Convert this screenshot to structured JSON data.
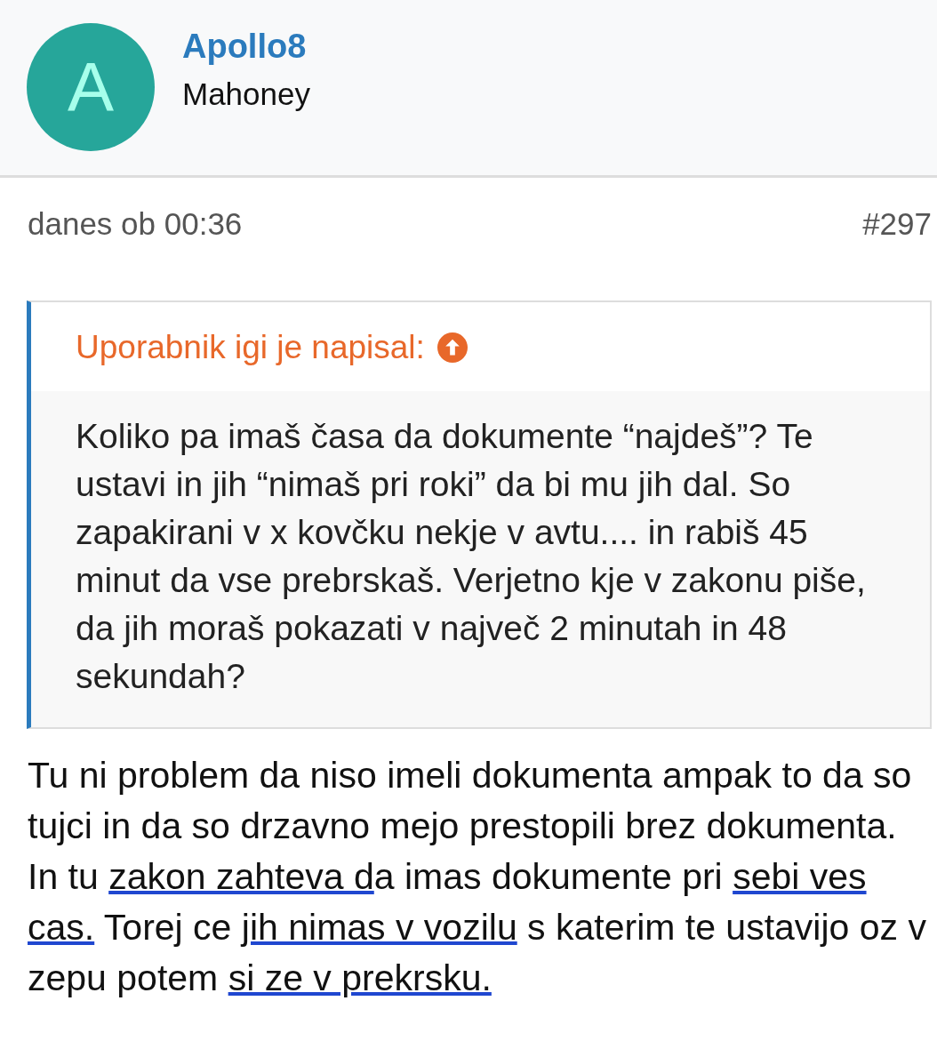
{
  "author": {
    "avatar_letter": "A",
    "username": "Apollo8",
    "subtitle": "Mahoney"
  },
  "post_meta": {
    "time": "danes ob 00:36",
    "number": "#297"
  },
  "quote": {
    "attribution": "Uporabnik igi je napisal:",
    "text": "Koliko pa imaš časa da dokumente “najdeš”? Te ustavi in jih “nimaš pri roki” da bi mu jih dal. So zapakirani v x kovčku nekje v avtu.... in rabiš 45 minut da vse prebrskaš. Verjetno kje v zakonu piše, da jih moraš pokazati v največ 2 minutah in 48 sekundah?"
  },
  "reply": [
    {
      "text": "Tu ni problem da niso imeli dokumenta ampak to da so tujci in da so drzavno mejo prestopili brez dokumenta. In tu ",
      "underlined": false
    },
    {
      "text": "zakon zahteva d",
      "underlined": true
    },
    {
      "text": "a imas dokumente pri ",
      "underlined": false
    },
    {
      "text": "sebi ves cas.",
      "underlined": true
    },
    {
      "text": " Torej ce ",
      "underlined": false
    },
    {
      "text": "jih nimas v vozilu",
      "underlined": true
    },
    {
      "text": " s katerim te ustavijo oz v zepu potem ",
      "underlined": false
    },
    {
      "text": "si ze v prekrsku.",
      "underlined": true
    }
  ]
}
